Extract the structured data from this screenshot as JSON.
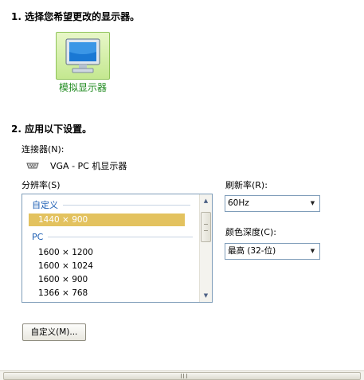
{
  "step1": {
    "heading": "1. 选择您希望更改的显示器。",
    "monitors": [
      {
        "label": "模拟显示器",
        "icon": "monitor-icon",
        "selected": true
      }
    ]
  },
  "step2": {
    "heading": "2. 应用以下设置。",
    "connector_label": "连接器(N):",
    "connector_icon": "vga-port-icon",
    "connector_value": "VGA - PC 机显示器",
    "resolution_label": "分辨率(S)",
    "resolution_groups": [
      {
        "name": "自定义",
        "items": [
          "1440 × 900"
        ]
      },
      {
        "name": "PC",
        "items": [
          "1600 × 1200",
          "1600 × 1024",
          "1600 × 900",
          "1366 × 768"
        ]
      }
    ],
    "selected_resolution": "1440 × 900",
    "refresh_label": "刷新率(R):",
    "refresh_value": "60Hz",
    "depth_label": "颜色深度(C):",
    "depth_value": "最高 (32-位)",
    "custom_button": "自定义(M)...",
    "colors": {
      "group_header": "#1e5fb4",
      "selection": "#e3c25f",
      "monitor_caption": "#1e8a1e"
    }
  }
}
